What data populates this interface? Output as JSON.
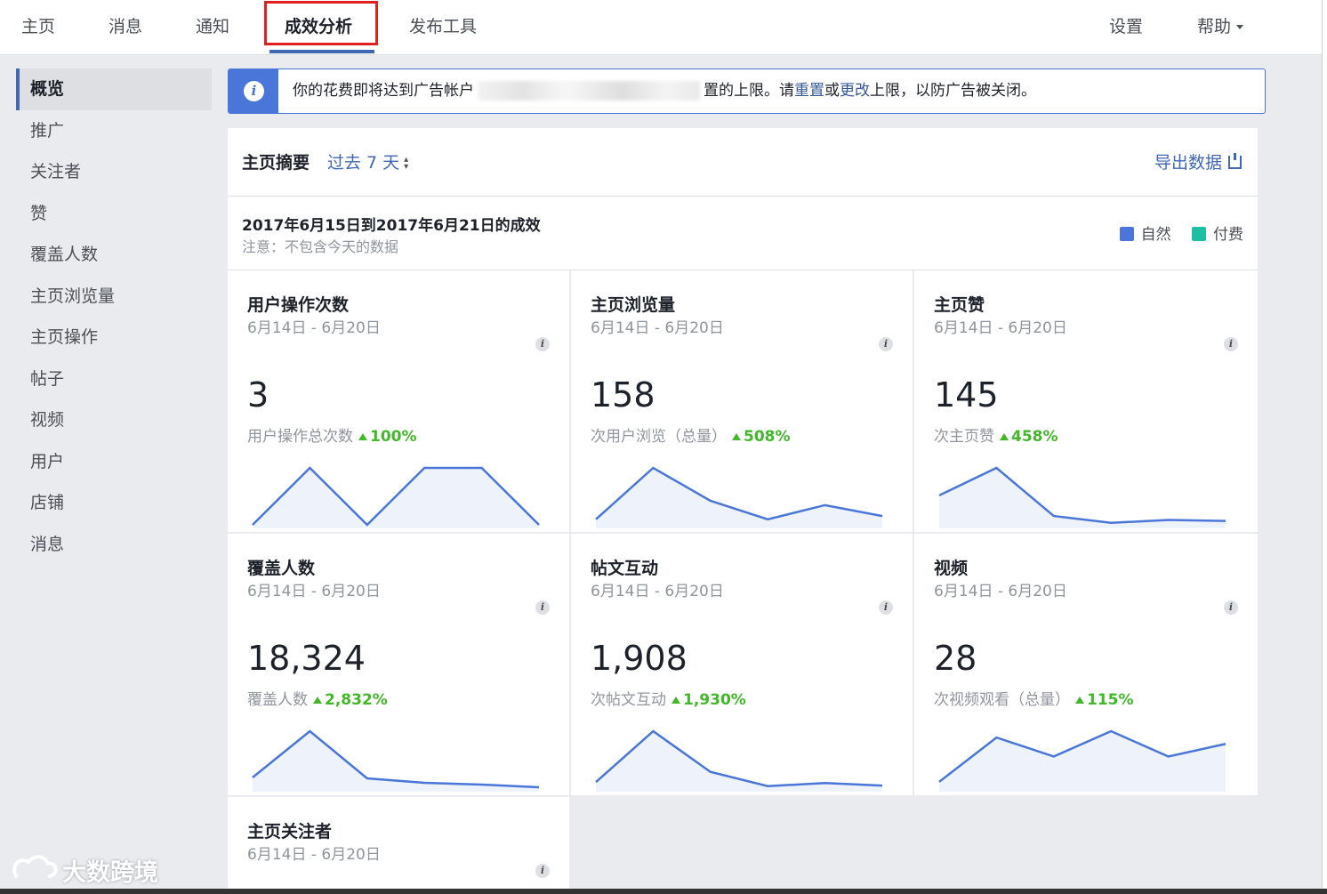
{
  "nav": {
    "tabs": [
      "主页",
      "消息",
      "通知",
      "成效分析",
      "发布工具"
    ],
    "active_tab": "成效分析",
    "settings": "设置",
    "help": "帮助"
  },
  "sidebar": {
    "items": [
      "概览",
      "推广",
      "关注者",
      "赞",
      "覆盖人数",
      "主页浏览量",
      "主页操作",
      "帖子",
      "视频",
      "用户",
      "店铺",
      "消息"
    ],
    "active": "概览"
  },
  "banner": {
    "text_before": "你的花费即将达到广告帐户",
    "text_after": "置的上限。请",
    "link_reset": "重置",
    "text_or": "或",
    "link_change": "更改",
    "text_end": "上限，以防广告被关闭。",
    "icon": "info-icon"
  },
  "summary": {
    "title": "主页摘要",
    "period": "过去 7 天",
    "export": "导出数据",
    "range": "2017年6月15日到2017年6月21日的成效",
    "note": "注意：不包含今天的数据",
    "legend": [
      {
        "label": "自然",
        "color": "#4a76d9"
      },
      {
        "label": "付费",
        "color": "#1dbfa3"
      }
    ]
  },
  "cards": [
    {
      "title": "用户操作次数",
      "date": "6月14日 - 6月20日",
      "value": "3",
      "label": "用户操作总次数",
      "change": "100%",
      "trend": [
        0,
        1,
        0,
        1,
        1,
        0
      ]
    },
    {
      "title": "主页浏览量",
      "date": "6月14日 - 6月20日",
      "value": "158",
      "label": "次用户浏览（总量）",
      "change": "508%",
      "trend": [
        5,
        52,
        22,
        5,
        18,
        8
      ]
    },
    {
      "title": "主页赞",
      "date": "6月14日 - 6月20日",
      "value": "145",
      "label": "次主页赞",
      "change": "458%",
      "trend": [
        30,
        58,
        9,
        2,
        5,
        4
      ]
    },
    {
      "title": "覆盖人数",
      "date": "6月14日 - 6月20日",
      "value": "18,324",
      "label": "覆盖人数",
      "change": "2,832%",
      "trend": [
        1200,
        6400,
        1100,
        600,
        400,
        100
      ]
    },
    {
      "title": "帖文互动",
      "date": "6月14日 - 6月20日",
      "value": "1,908",
      "label": "次帖文互动",
      "change": "1,930%",
      "trend": [
        60,
        560,
        160,
        20,
        50,
        25
      ]
    },
    {
      "title": "视频",
      "date": "6月14日 - 6月20日",
      "value": "28",
      "label": "次视频观看（总量）",
      "change": "115%",
      "trend": [
        1,
        8,
        5,
        9,
        5,
        7
      ]
    },
    {
      "title": "主页关注者",
      "date": "6月14日 - 6月20日",
      "value": "",
      "label": "",
      "change": "",
      "trend": []
    }
  ],
  "watermark": "大数跨境",
  "colors": {
    "accent": "#4267b2",
    "positive": "#42b72a",
    "highlight_box": "#e02020"
  }
}
